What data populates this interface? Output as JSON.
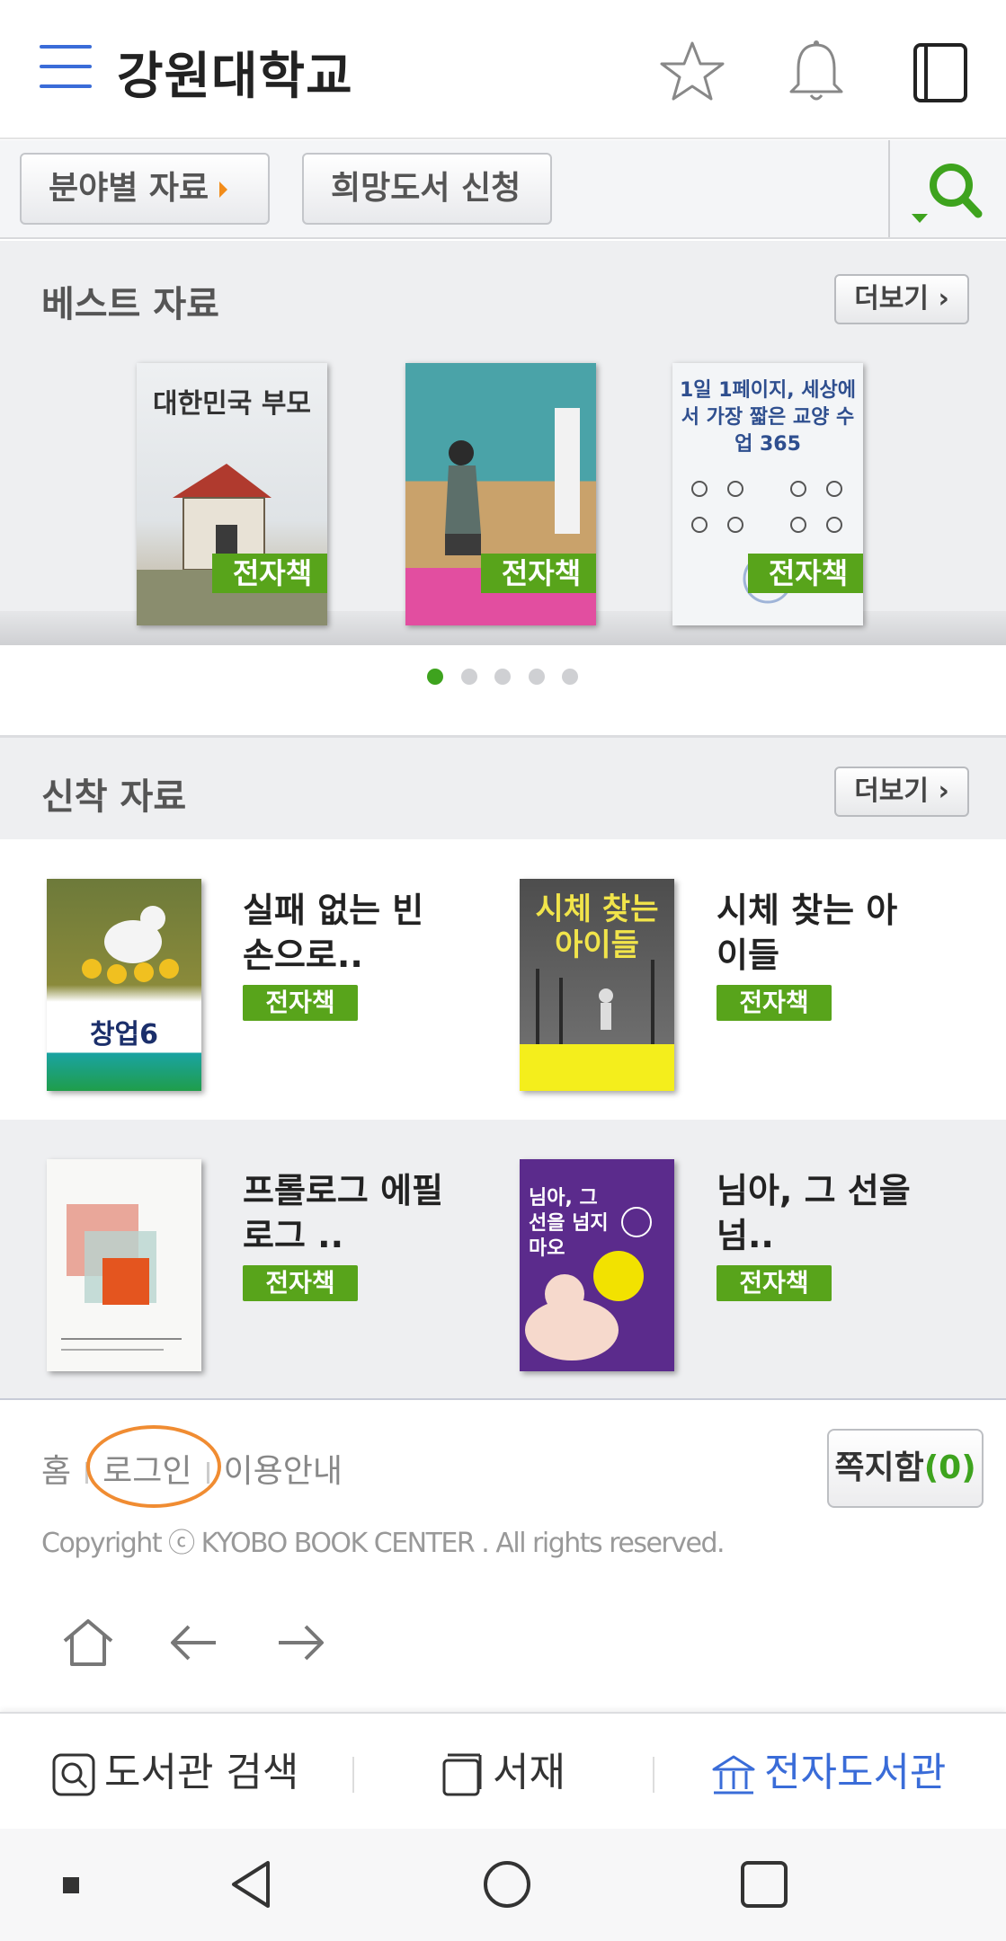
{
  "header": {
    "title": "강원대학교",
    "icons": [
      "menu-icon",
      "star-icon",
      "bell-icon",
      "book-icon"
    ]
  },
  "search_row": {
    "field_button": "분야별 자료",
    "wish_button": "희망도서 신청",
    "search_icon": "search-icon"
  },
  "best": {
    "title": "베스트 자료",
    "more": "더보기",
    "books": [
      {
        "cover_text": "대한민국 부모",
        "tag": "전자책"
      },
      {
        "cover_text": "",
        "tag": "전자책"
      },
      {
        "cover_text": "1일 1페이지, 세상에서 가장 짧은 교양 수업 365",
        "tag": "전자책"
      }
    ],
    "pager": {
      "pages": 5,
      "active": 0
    }
  },
  "new": {
    "title": "신착 자료",
    "more": "더보기",
    "books": [
      {
        "title": "실패 없는 빈손으로..",
        "tag": "전자책",
        "cover_text": "창업6"
      },
      {
        "title": "시체 찾는 아이들",
        "tag": "전자책",
        "cover_text": "시체 찾는 아이들"
      },
      {
        "title": "프롤로그 에필로그 ..",
        "tag": "전자책",
        "cover_text": ""
      },
      {
        "title": "님아, 그 선을 넘..",
        "tag": "전자책",
        "cover_text": "님아, 그 선을 넘지 마오"
      }
    ]
  },
  "footer": {
    "home": "홈",
    "login": "로그인",
    "guide": "이용안내",
    "note_label": "쪽지함",
    "note_count": "(0)",
    "copyright": "Copyright ⓒ KYOBO BOOK CENTER . All rights reserved."
  },
  "tabbar": {
    "search": "도서관 검색",
    "shelf": "서재",
    "elib": "전자도서관"
  },
  "colors": {
    "accent_blue": "#3a6cd8",
    "ebook_green": "#58a41b",
    "highlight_orange": "#f08c32"
  }
}
